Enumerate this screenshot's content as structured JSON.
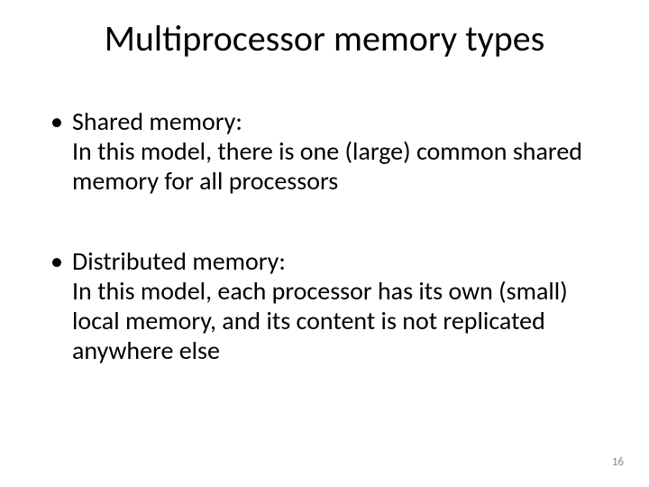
{
  "title": "Multiprocessor memory types",
  "bullets": [
    {
      "term": "Shared memory",
      "desc": "In this model, there is one (large) common shared memory for all processors"
    },
    {
      "term": "Distributed memory",
      "desc": "In this model, each processor has its own (small) local memory, and its content is not replicated anywhere else"
    }
  ],
  "page_number": "16"
}
